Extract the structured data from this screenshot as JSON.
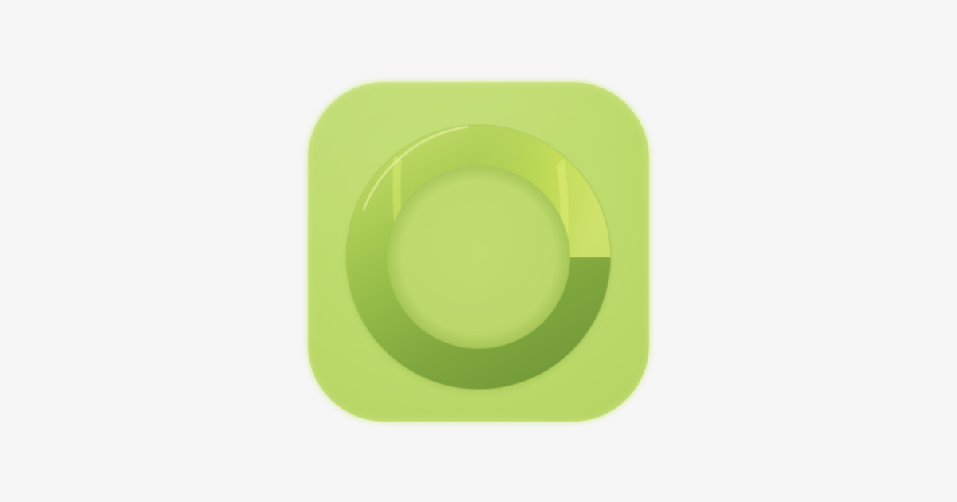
{
  "app_icon": {
    "icon_name": "ring-icon",
    "colors": {
      "page_background": "#f6f6f6",
      "tile": "#c0dc70",
      "ring_dark": "#7aa03a",
      "ring_mid": "#95bd48",
      "ring_highlight": "#d9ec6a"
    }
  }
}
